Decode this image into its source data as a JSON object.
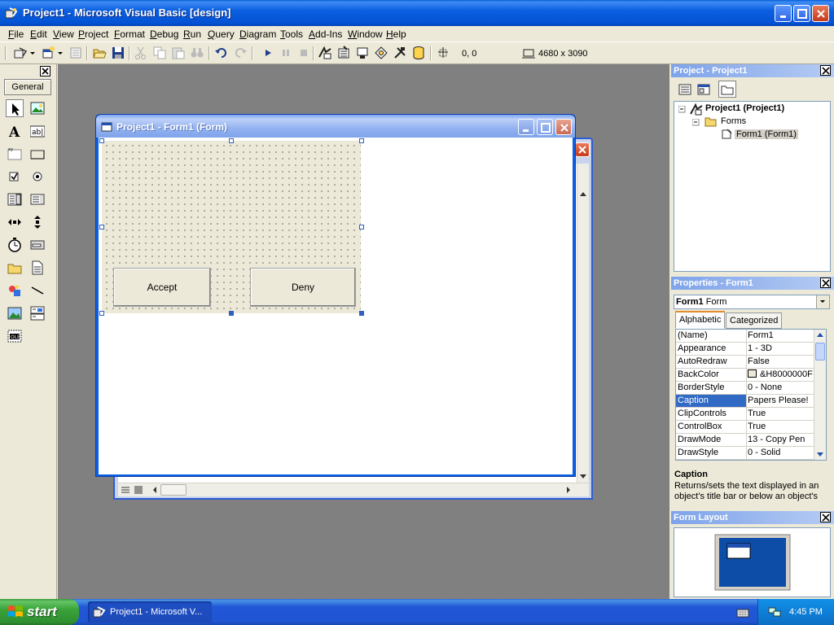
{
  "window": {
    "title": "Project1 - Microsoft Visual Basic [design]"
  },
  "menu": [
    "File",
    "Edit",
    "View",
    "Project",
    "Format",
    "Debug",
    "Run",
    "Query",
    "Diagram",
    "Tools",
    "Add-Ins",
    "Window",
    "Help"
  ],
  "toolbar": {
    "position": "0, 0",
    "size": "4680 x 3090"
  },
  "toolbox": {
    "tab_label": "General"
  },
  "form_window": {
    "title": "Project1 - Form1 (Form)"
  },
  "form": {
    "accept_label": "Accept",
    "deny_label": "Deny"
  },
  "project_explorer": {
    "title": "Project - Project1",
    "root": "Project1 (Project1)",
    "folder": "Forms",
    "item": "Form1 (Form1)"
  },
  "properties": {
    "title": "Properties - Form1",
    "object_name": "Form1",
    "object_type": "Form",
    "tab_alphabetic": "Alphabetic",
    "tab_categorized": "Categorized",
    "rows": [
      {
        "name": "(Name)",
        "value": "Form1"
      },
      {
        "name": "Appearance",
        "value": "1 - 3D"
      },
      {
        "name": "AutoRedraw",
        "value": "False"
      },
      {
        "name": "BackColor",
        "value": "&H8000000F"
      },
      {
        "name": "BorderStyle",
        "value": "0 - None"
      },
      {
        "name": "Caption",
        "value": "Papers Please!"
      },
      {
        "name": "ClipControls",
        "value": "True"
      },
      {
        "name": "ControlBox",
        "value": "True"
      },
      {
        "name": "DrawMode",
        "value": "13 - Copy Pen"
      },
      {
        "name": "DrawStyle",
        "value": "0 - Solid"
      }
    ],
    "selected_row": 5,
    "desc_title": "Caption",
    "desc_text": "Returns/sets the text displayed in an object's title bar or below an object's"
  },
  "form_layout": {
    "title": "Form Layout"
  },
  "taskbar": {
    "start_label": "start",
    "task_label": "Project1 - Microsoft V...",
    "clock": "4:45 PM"
  },
  "colors": {
    "xp_blue": "#0b5fe0",
    "selection": "#316ac5",
    "mdi_background": "#808080"
  }
}
